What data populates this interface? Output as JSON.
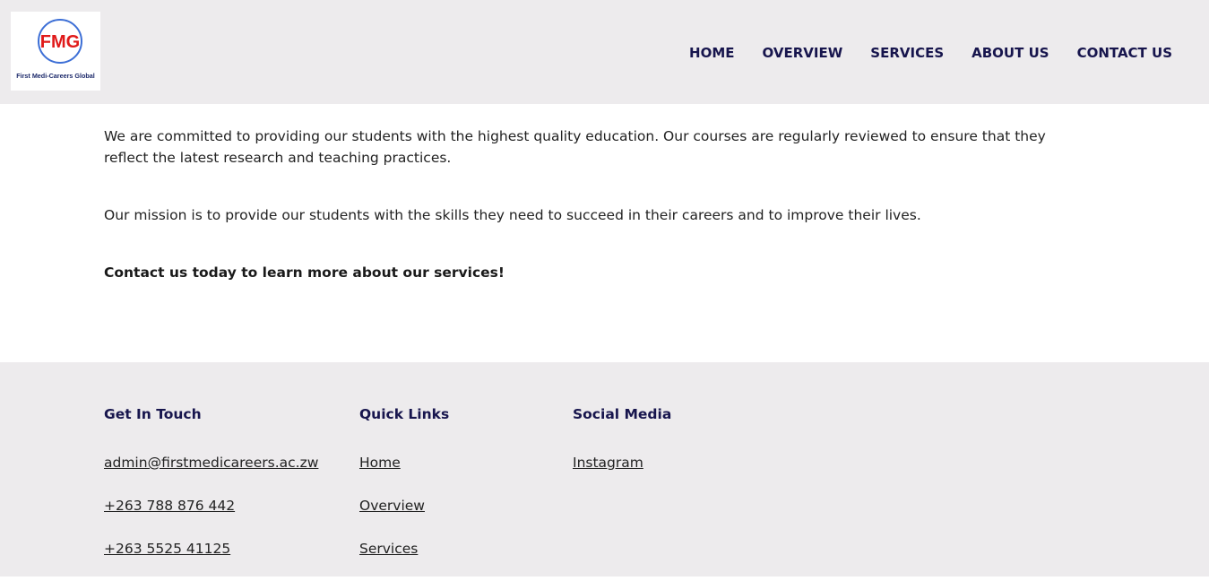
{
  "header": {
    "logo_text": "FMG",
    "logo_subtitle": "First Medi-Careers Global",
    "nav": [
      {
        "label": "HOME"
      },
      {
        "label": "OVERVIEW"
      },
      {
        "label": "SERVICES"
      },
      {
        "label": "ABOUT US"
      },
      {
        "label": "CONTACT US"
      }
    ]
  },
  "main": {
    "paragraph_1": "We are committed to providing our students with the highest quality education. Our courses are regularly reviewed to ensure that they reflect the latest research and teaching practices.",
    "paragraph_2": "Our mission is to provide our students with the skills they need to succeed in their careers and to improve their lives.",
    "cta": "Contact us today to learn more about our services!"
  },
  "footer": {
    "get_in_touch": {
      "title": "Get In Touch",
      "items": [
        "admin@firstmedicareers.ac.zw",
        "+263 788 876 442",
        "+263 5525 41125"
      ]
    },
    "quick_links": {
      "title": "Quick Links",
      "items": [
        "Home",
        "Overview",
        "Services"
      ]
    },
    "social_media": {
      "title": "Social Media",
      "items": [
        "Instagram"
      ]
    }
  },
  "colors": {
    "nav_text": "#17154d",
    "header_bg": "#edebed",
    "logo_red": "#e01a1a",
    "logo_blue": "#1d3f9a"
  }
}
